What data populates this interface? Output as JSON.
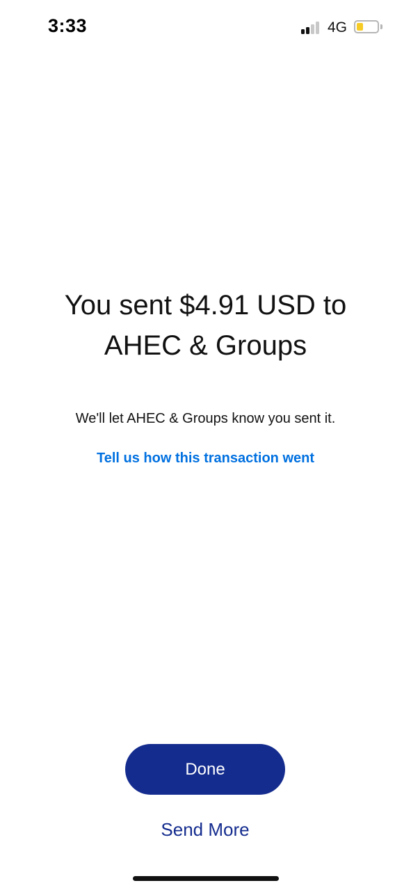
{
  "status_bar": {
    "time": "3:33",
    "network": "4G",
    "signal_icon": "cellular-signal-icon",
    "battery_icon": "battery-icon",
    "battery_level": 0.2,
    "battery_color": "#f7cb26"
  },
  "confirmation": {
    "headline_line1": "You sent $4.91 USD to",
    "headline_line2": "AHEC & Groups",
    "subtext": "We'll let AHEC & Groups know you sent it.",
    "feedback_link": "Tell us how this transaction went"
  },
  "actions": {
    "done_label": "Done",
    "send_more_label": "Send More"
  },
  "colors": {
    "primary_button": "#142c8e",
    "link": "#0070e0",
    "text": "#111111"
  }
}
